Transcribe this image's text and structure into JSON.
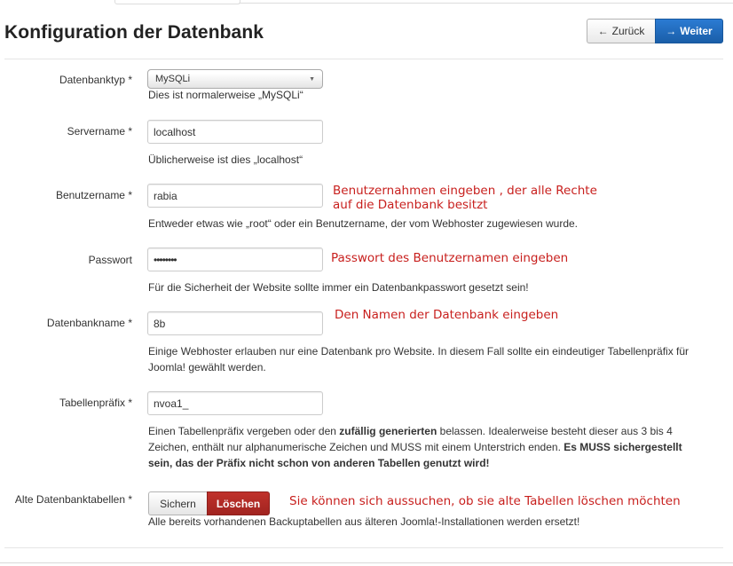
{
  "page": {
    "title": "Konfiguration der Datenbank"
  },
  "nav": {
    "back_label": "Zurück",
    "next_label": "Weiter"
  },
  "fields": {
    "db_type": {
      "label": "Datenbanktyp *",
      "value": "MySQLi",
      "hint": "Dies ist normalerweise „MySQLi“"
    },
    "host": {
      "label": "Servername *",
      "value": "localhost",
      "hint": "Üblicherweise ist dies „localhost“"
    },
    "user": {
      "label": "Benutzername *",
      "value": "rabia",
      "hint": "Entweder etwas wie „root“ oder ein Benutzername, der vom Webhoster zugewiesen wurde."
    },
    "password": {
      "label": "Passwort",
      "value": "••••••••",
      "hint": "Für die Sicherheit der Website sollte immer ein Datenbankpasswort gesetzt sein!"
    },
    "db_name": {
      "label": "Datenbankname *",
      "value": "8b",
      "hint_line1": "Einige Webhoster erlauben nur eine Datenbank pro Website. In diesem Fall sollte ein eindeutiger Tabellenpräfix für",
      "hint_line2": "Joomla! gewählt werden."
    },
    "prefix": {
      "label": "Tabellenpräfix *",
      "value": "nvoa1_",
      "hint_part1": "Einen Tabellenpräfix vergeben oder den ",
      "hint_bold1": "zufällig generierten",
      "hint_part2": " belassen. Idealerweise besteht dieser aus 3 bis 4",
      "hint_line2_part1": "Zeichen, enthält nur alphanumerische Zeichen und MUSS mit einem Unterstrich enden. ",
      "hint_line2_bold": "Es MUSS sichergestellt",
      "hint_line3_bold": "sein, das der Präfix nicht schon von anderen Tabellen genutzt wird!"
    },
    "old_tables": {
      "label": "Alte Datenbanktabellen *",
      "option_keep": "Sichern",
      "option_delete": "Löschen",
      "selected": "Löschen",
      "hint": "Alle bereits vorhandenen Backuptabellen aus älteren Joomla!-Installationen werden ersetzt!"
    }
  },
  "annotations": {
    "user_line1": "Benutzernahmen eingeben , der alle Rechte",
    "user_line2": "auf die Datenbank besitzt",
    "password": "Passwort des Benutzernamen eingeben",
    "db_name": "Den Namen der  Datenbank eingeben",
    "old_tables": "Sie können  sich aussuchen, ob sie alte Tabellen löschen möchten"
  },
  "colors": {
    "annotation": "#c8201e",
    "primary": "#1a5ea8",
    "danger": "#a12420"
  },
  "icons": {
    "back": "arrow-left-icon",
    "next": "arrow-right-icon",
    "select": "caret-down-icon"
  }
}
